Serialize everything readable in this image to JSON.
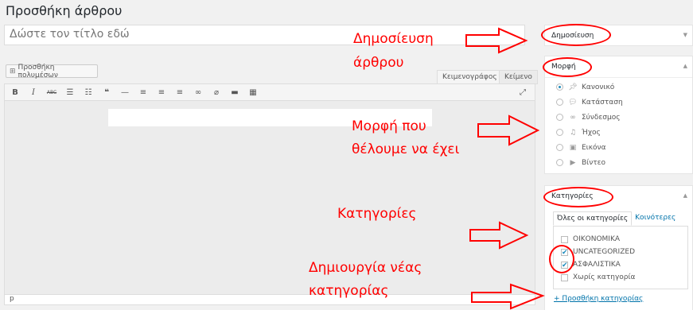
{
  "page": {
    "title": "Προσθήκη άρθρου"
  },
  "title_input": {
    "placeholder": "Δώστε τον τίτλο εδώ"
  },
  "editor": {
    "add_media_label": "Προσθήκη πολυμέσων",
    "tabs": [
      {
        "label": "Κειμενογράφος"
      },
      {
        "label": "Κείμενο"
      }
    ],
    "toolbar": {
      "bold": "B",
      "italic": "I",
      "strike": "ABC",
      "ul": "☰",
      "ol": "☷",
      "quote": "❝",
      "hr": "—",
      "align_left": "≡",
      "align_center": "≡",
      "align_right": "≡",
      "link": "∞",
      "unlink": "⌀",
      "more": "▬",
      "kitchen": "▦",
      "fullscreen": "⤢"
    },
    "status_path": "p"
  },
  "sidebar": {
    "publish": {
      "title": "Δημοσίευση"
    },
    "format": {
      "title": "Μορφή",
      "items": [
        {
          "label": "Κανονικό",
          "icon": "pin-icon"
        },
        {
          "label": "Κατάσταση",
          "icon": "speech-bubble-icon"
        },
        {
          "label": "Σύνδεσμος",
          "icon": "link-icon"
        },
        {
          "label": "Ήχος",
          "icon": "music-note-icon"
        },
        {
          "label": "Εικόνα",
          "icon": "image-icon"
        },
        {
          "label": "Βίντεο",
          "icon": "video-icon"
        }
      ],
      "selected": "Κανονικό"
    },
    "categories": {
      "title": "Κατηγορίες",
      "tabs": [
        {
          "label": "Όλες οι κατηγορίες"
        },
        {
          "label": "Κοινότερες"
        }
      ],
      "items": [
        {
          "label": "ΟΙΚΟΝΟΜΙΚΑ",
          "checked": false
        },
        {
          "label": "UNCATEGORIZED",
          "checked": true
        },
        {
          "label": "ΑΣΦΑΛΙΣΤΙΚΑ",
          "checked": true
        },
        {
          "label": "Χωρίς κατηγορία",
          "checked": false
        }
      ],
      "add_new_label": "+ Προσθήκη κατηγορίας"
    }
  },
  "annotations": {
    "publish_line1": "Δημοσίευση",
    "publish_line2": "άρθρου",
    "format_line1": "Μορφή που",
    "format_line2": "θέλουμε να έχει",
    "categories": "Κατηγορίες",
    "new_cat_line1": "Δημιουργία νέας",
    "new_cat_line2": "κατηγορίας",
    "color": "#ff0000"
  }
}
